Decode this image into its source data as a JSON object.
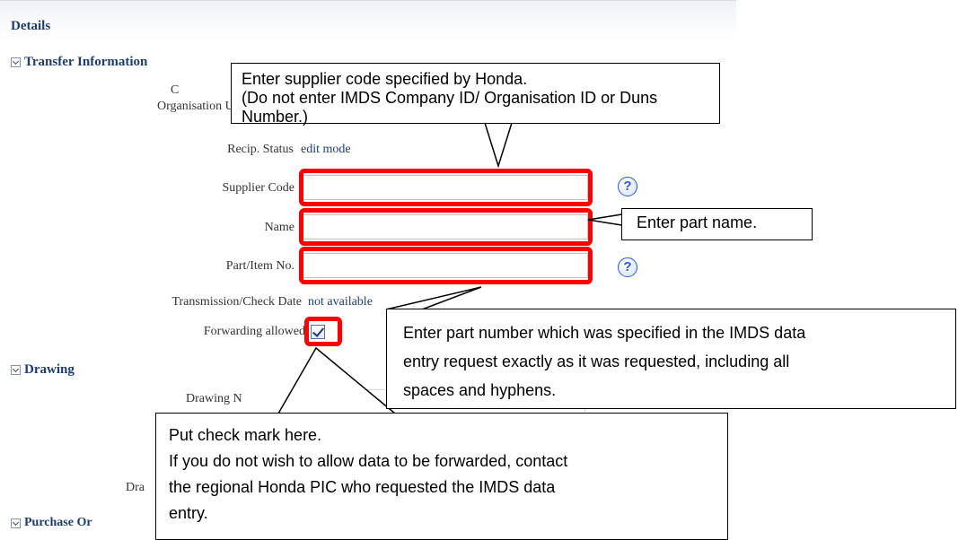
{
  "panel": {
    "title": "Details",
    "sections": {
      "transfer": "Transfer Information",
      "drawing": "Drawing",
      "purchase": "Purchase Or"
    }
  },
  "fields": {
    "row1_label": "C",
    "organisation_label": "Organisation Unit",
    "recip_status_label": "Recip. Status",
    "recip_status_value": "edit mode",
    "supplier_code_label": "Supplier Code",
    "supplier_code_value": "",
    "name_label": "Name",
    "name_value": "",
    "part_no_label": "Part/Item No.",
    "part_no_value": "",
    "transmission_label": "Transmission/Check Date",
    "transmission_value": "not available",
    "forwarding_label": "Forwarding allowed",
    "forwarding_checked": true,
    "drawing_label": "Drawing N",
    "drawing_label2": "Dra"
  },
  "callouts": {
    "supplier": [
      "Enter supplier code specified by Honda.",
      "(Do not enter IMDS Company ID/ Organisation ID or Duns Number.)"
    ],
    "name": "Enter part name.",
    "part_number": [
      "Enter part number which was specified in the IMDS data",
      "entry request exactly as it was requested, including all",
      "spaces and hyphens."
    ],
    "checkmark": [
      "Put check mark here.",
      "If you do not wish to allow data to be forwarded, contact",
      "the regional Honda PIC who requested the IMDS data",
      "entry."
    ]
  },
  "icons": {
    "help": "question-mark-icon",
    "collapse": "chevron-down-icon",
    "check": "checkmark-icon"
  },
  "colors": {
    "highlight": "#ff0000",
    "section_text": "#1f3d6b",
    "help_icon": "#2f59c6"
  }
}
